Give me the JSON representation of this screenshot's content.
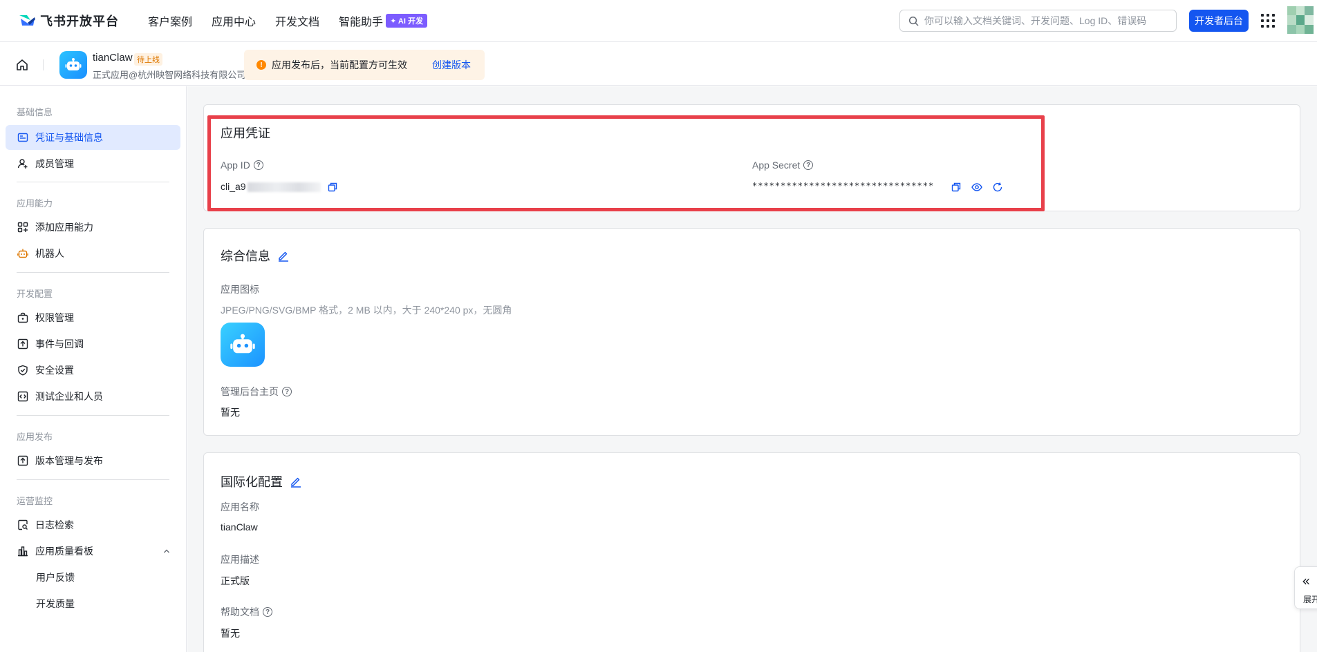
{
  "brand": {
    "name": "飞书开放平台"
  },
  "topnav": {
    "links": [
      "客户案例",
      "应用中心",
      "开发文档",
      "智能助手"
    ],
    "ai_badge": "✦ AI 开发",
    "search_placeholder": "你可以输入文档关键词、开发问题、Log ID、错误码",
    "dev_button": "开发者后台"
  },
  "app": {
    "name": "tianClaw",
    "status": "待上线",
    "org": "正式应用@杭州映智网络科技有限公司"
  },
  "notice": {
    "text": "应用发布后，当前配置方可生效",
    "link": "创建版本"
  },
  "sidebar": {
    "sections": [
      {
        "title": "基础信息",
        "items": [
          "凭证与基础信息",
          "成员管理"
        ]
      },
      {
        "title": "应用能力",
        "items": [
          "添加应用能力",
          "机器人"
        ]
      },
      {
        "title": "开发配置",
        "items": [
          "权限管理",
          "事件与回调",
          "安全设置",
          "测试企业和人员"
        ]
      },
      {
        "title": "应用发布",
        "items": [
          "版本管理与发布"
        ]
      },
      {
        "title": "运营监控",
        "items": [
          "日志检索",
          "应用质量看板",
          "用户反馈",
          "开发质量"
        ]
      }
    ]
  },
  "credentials": {
    "title": "应用凭证",
    "app_id_label": "App ID",
    "app_id_value": "cli_a9",
    "app_secret_label": "App Secret",
    "app_secret_value": "********************************"
  },
  "general": {
    "title": "综合信息",
    "icon_label": "应用图标",
    "icon_hint": "JPEG/PNG/SVG/BMP 格式，2 MB 以内，大于 240*240 px，无圆角",
    "admin_home_label": "管理后台主页",
    "admin_home_value": "暂无"
  },
  "i18n": {
    "title": "国际化配置",
    "name_label": "应用名称",
    "name_value": "tianClaw",
    "desc_label": "应用描述",
    "desc_value": "正式版",
    "help_label": "帮助文档",
    "help_value": "暂无"
  },
  "expand": {
    "label": "展开"
  },
  "colors": {
    "primary": "#1456f0",
    "highlight": "#e8404a",
    "warning": "#ff8800"
  }
}
